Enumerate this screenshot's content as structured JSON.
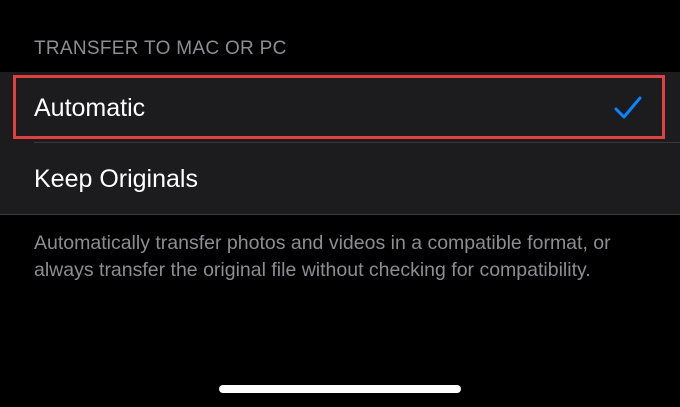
{
  "section": {
    "header": "TRANSFER TO MAC OR PC"
  },
  "options": [
    {
      "label": "Automatic",
      "selected": true
    },
    {
      "label": "Keep Originals",
      "selected": false
    }
  ],
  "footer": {
    "text": "Automatically transfer photos and videos in a compatible format, or always transfer the original file without checking for compatibility."
  },
  "icons": {
    "selected_indicator": "checkmark-icon"
  },
  "colors": {
    "background": "#000000",
    "cell_background": "#1c1c1e",
    "secondary_text": "#8d8d92",
    "accent": "#0a84ff",
    "highlight": "#e0413f",
    "separator": "#38383a"
  }
}
